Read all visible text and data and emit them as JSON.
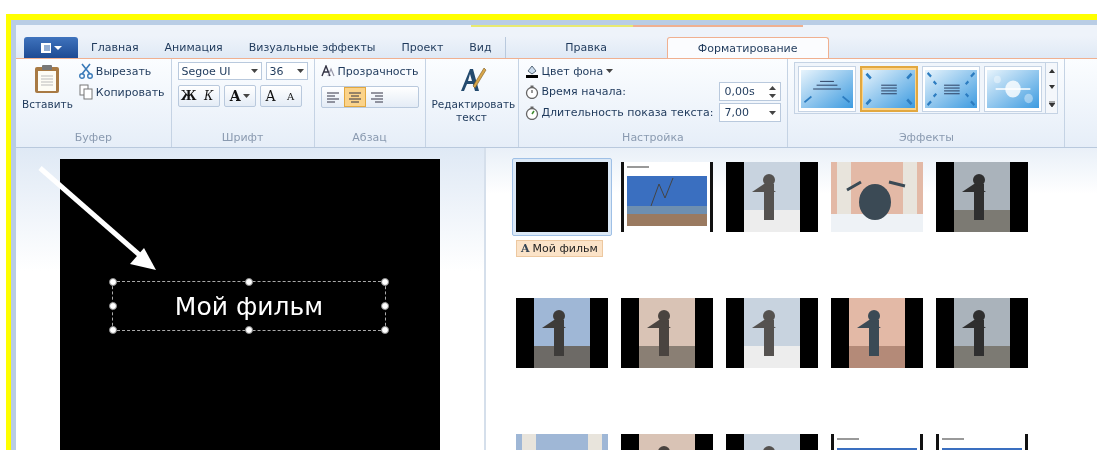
{
  "tabs": [
    {
      "kind": "app-menu",
      "selected": false
    },
    {
      "label": "Главная",
      "kind": "normal",
      "selected": false
    },
    {
      "label": "Анимация",
      "kind": "normal",
      "selected": false
    },
    {
      "label": "Визуальные эффекты",
      "kind": "normal",
      "selected": false
    },
    {
      "label": "Проект",
      "kind": "normal",
      "selected": false
    },
    {
      "label": "Вид",
      "kind": "normal",
      "selected": false
    },
    {
      "label": "Правка",
      "kind": "contextual",
      "selected": false
    },
    {
      "label": "Форматирование",
      "kind": "contextual",
      "selected": true
    }
  ],
  "buffer": {
    "paste": "Вставить",
    "cut": "Вырезать",
    "copy": "Копировать",
    "label": "Буфер"
  },
  "font": {
    "family": "Segoe UI",
    "size": "36",
    "bold": "Ж",
    "italic": "К",
    "color_letter": "A",
    "grow": "A",
    "shrink": "A",
    "label": "Шрифт"
  },
  "paragraph": {
    "transparency": "Прозрачность",
    "align": [
      {
        "selected": false
      },
      {
        "selected": true
      },
      {
        "selected": false
      }
    ],
    "label": "Абзац"
  },
  "edit_text": "Редактировать текст",
  "settings": {
    "bg_color": "Цвет фона",
    "start_label": "Время начала:",
    "start_value": "0,00s",
    "duration_label": "Длительность показа текста:",
    "duration_value": "7,00",
    "label": "Настройка"
  },
  "effects": {
    "items": [
      {
        "kind": "fly",
        "selected": false
      },
      {
        "kind": "zoom",
        "selected": true
      },
      {
        "kind": "multi",
        "selected": false
      },
      {
        "kind": "glow",
        "selected": false
      }
    ],
    "label": "Эффекты"
  },
  "preview": {
    "caption": "Мой фильм"
  },
  "storyboard": [
    {
      "kind": "blank",
      "selected": true,
      "caption": "Мой фильм",
      "caption_mark": "A"
    },
    {
      "kind": "title",
      "selected": false
    },
    {
      "kind": "portrait",
      "selected": false
    },
    {
      "kind": "landscape",
      "selected": false
    },
    {
      "kind": "portrait",
      "selected": false
    },
    {
      "kind": "portrait",
      "selected": false
    },
    {
      "kind": "portrait",
      "selected": false
    },
    {
      "kind": "portrait",
      "selected": false
    },
    {
      "kind": "portrait",
      "selected": false
    },
    {
      "kind": "portrait",
      "selected": false
    },
    {
      "kind": "landscape",
      "selected": false
    },
    {
      "kind": "portrait",
      "selected": false
    },
    {
      "kind": "portrait",
      "selected": false
    },
    {
      "kind": "title",
      "selected": false
    },
    {
      "kind": "title",
      "selected": false
    }
  ]
}
